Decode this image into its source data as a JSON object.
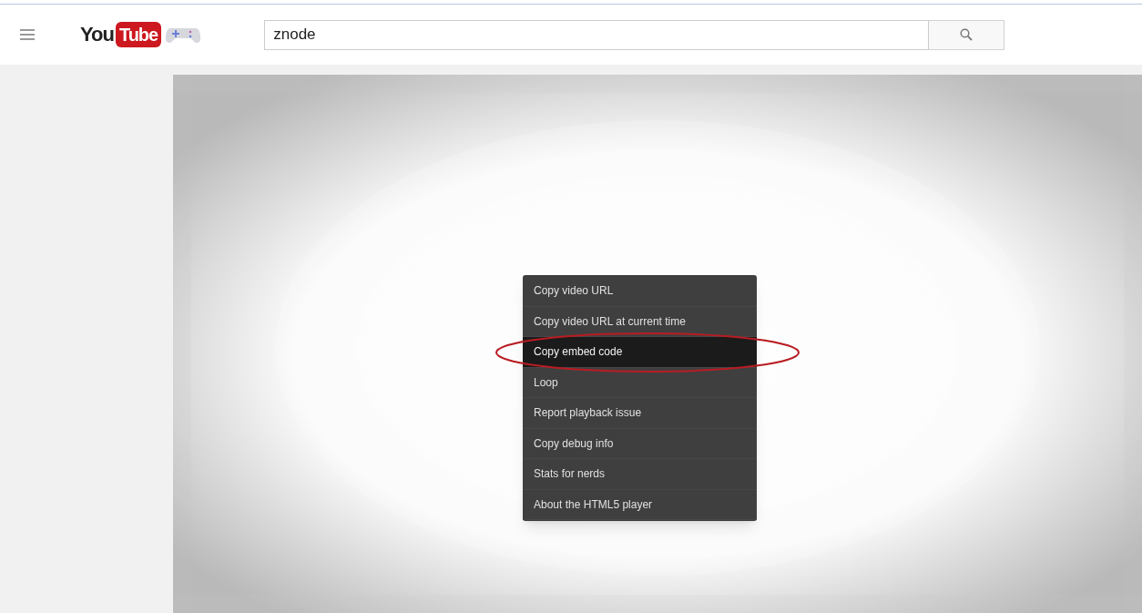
{
  "header": {
    "logo": {
      "left": "You",
      "right": "Tube"
    },
    "search": {
      "value": "znode"
    }
  },
  "context_menu": {
    "items": [
      {
        "label": "Copy video URL",
        "selected": false
      },
      {
        "label": "Copy video URL at current time",
        "selected": false
      },
      {
        "label": "Copy embed code",
        "selected": true
      },
      {
        "label": "Loop",
        "selected": false
      },
      {
        "label": "Report playback issue",
        "selected": false
      },
      {
        "label": "Copy debug info",
        "selected": false
      },
      {
        "label": "Stats for nerds",
        "selected": false
      },
      {
        "label": "About the HTML5 player",
        "selected": false
      }
    ]
  }
}
